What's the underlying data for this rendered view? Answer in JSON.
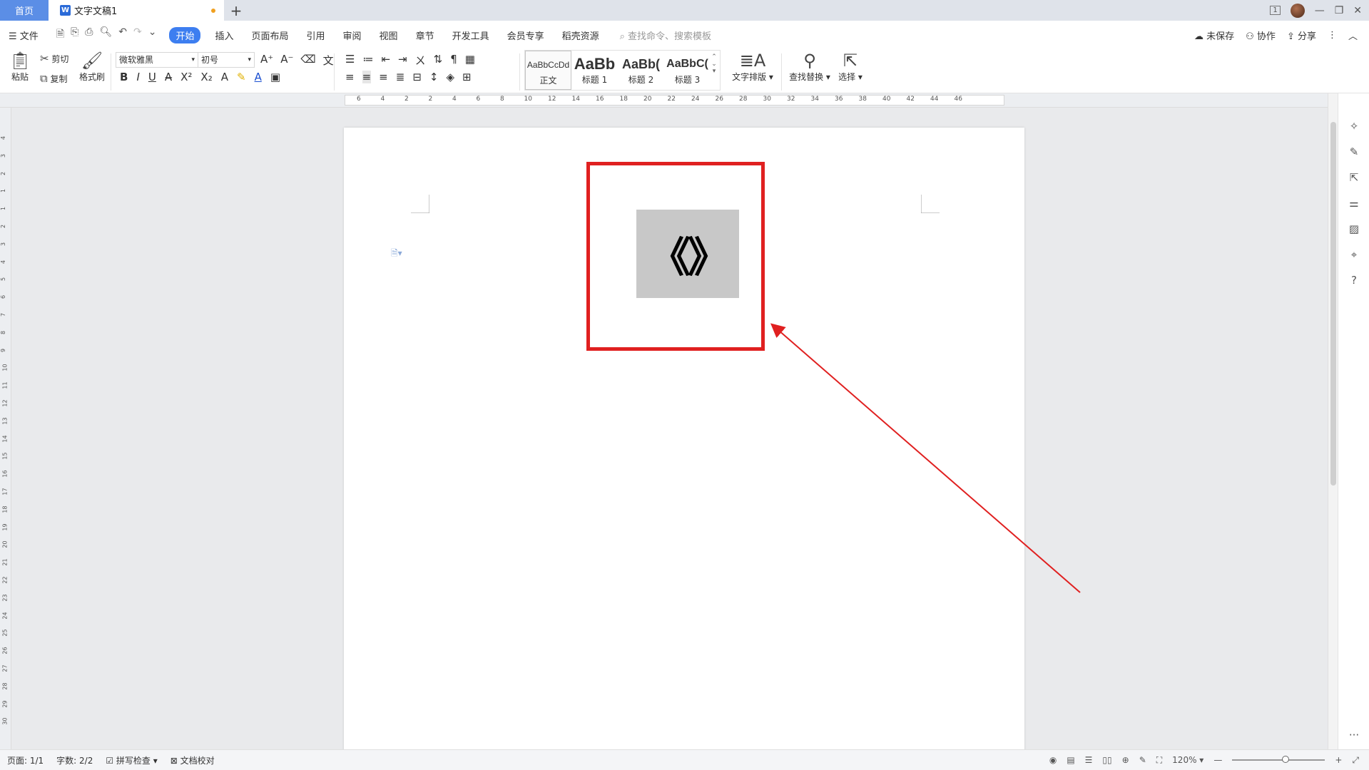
{
  "titlebar": {
    "home_tab": "首页",
    "doc_tab": "文字文稿1",
    "doc_icon": "W",
    "new_tab": "+",
    "layout_icon": "1",
    "min": "—",
    "max": "❐",
    "close": "✕"
  },
  "menubar": {
    "file": "文件",
    "items": [
      "开始",
      "插入",
      "页面布局",
      "引用",
      "审阅",
      "视图",
      "章节",
      "开发工具",
      "会员专享",
      "稻壳资源"
    ],
    "search_placeholder": "查找命令、搜索模板",
    "unsaved": "未保存",
    "collaborate": "协作",
    "share": "分享"
  },
  "ribbon": {
    "paste": "粘贴",
    "cut": "剪切",
    "copy": "复制",
    "format_painter": "格式刷",
    "font_name": "微软雅黑",
    "font_size": "初号",
    "styles": [
      {
        "preview": "AaBbCcDd",
        "name": "正文"
      },
      {
        "preview": "AaBb",
        "name": "标题 1"
      },
      {
        "preview": "AaBb(",
        "name": "标题 2"
      },
      {
        "preview": "AaBbC(",
        "name": "标题 3"
      }
    ],
    "text_layout": "文字排版",
    "find_replace": "查找替换",
    "select": "选择"
  },
  "ruler": {
    "h_ticks": [
      "6",
      "4",
      "2",
      "2",
      "4",
      "6",
      "8",
      "10",
      "12",
      "14",
      "16",
      "18",
      "20",
      "22",
      "24",
      "26",
      "28",
      "30",
      "32",
      "34",
      "36",
      "38",
      "40",
      "42",
      "44",
      "46"
    ],
    "v_ticks": [
      "4",
      "3",
      "2",
      "1",
      "1",
      "2",
      "3",
      "4",
      "5",
      "6",
      "7",
      "8",
      "9",
      "10",
      "11",
      "12",
      "13",
      "14",
      "15",
      "16",
      "17",
      "18",
      "19",
      "20",
      "21",
      "22",
      "23",
      "24",
      "25",
      "26",
      "27",
      "28",
      "29",
      "30"
    ]
  },
  "document": {
    "symbol_text": "《》"
  },
  "statusbar": {
    "page": "页面: 1/1",
    "words": "字数: 2/2",
    "spell_check": "拼写检查",
    "proofread": "文档校对",
    "zoom": "120%"
  },
  "colors": {
    "accent": "#3d7ef0",
    "highlight_border": "#e02020",
    "arrow": "#e02020",
    "home_tab": "#5b8ee6"
  }
}
